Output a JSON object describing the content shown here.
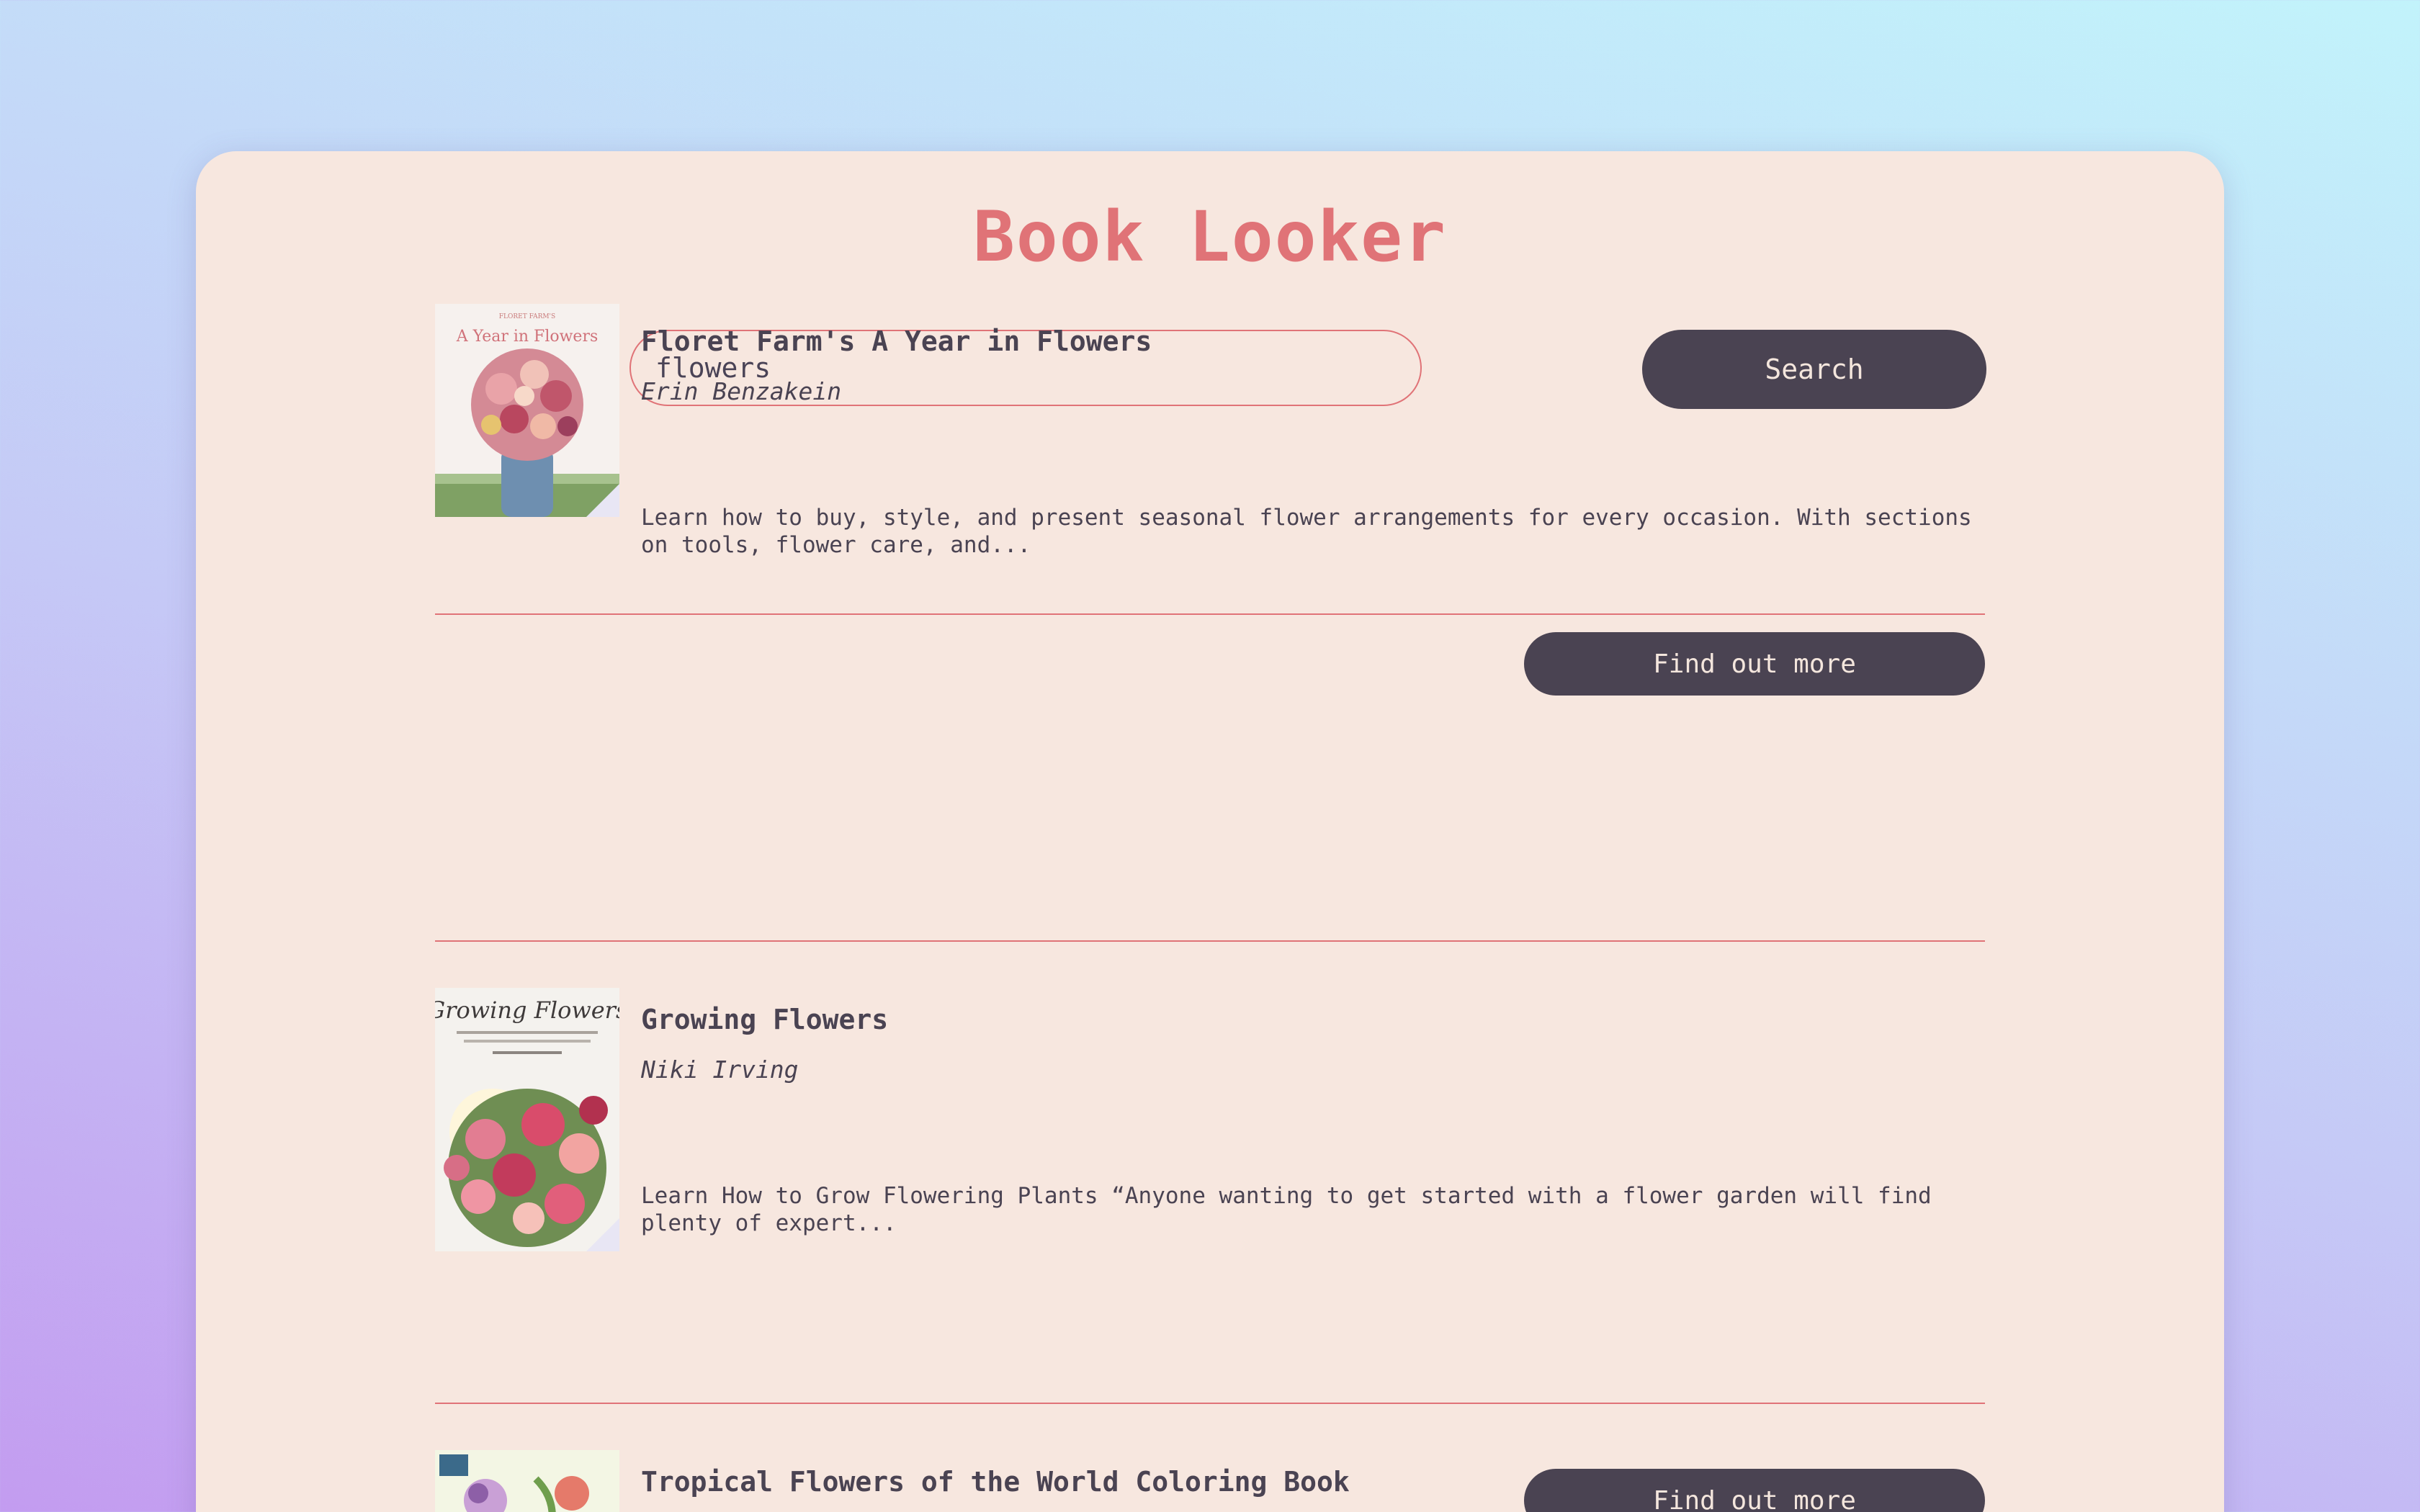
{
  "app": {
    "title": "Book Looker"
  },
  "search": {
    "value": "flowers",
    "button_label": "Search"
  },
  "results": [
    {
      "title": "Floret Farm's A Year in Flowers",
      "author": "Erin Benzakein",
      "description": "Learn how to buy, style, and present seasonal flower arrangements for every occasion. With sections on tools, flower care, and...",
      "button_label": "Find out more",
      "cover_text": "FLORET FARM'S A Year in Flowers"
    },
    {
      "title": "Growing Flowers",
      "author": "Niki Irving",
      "description": "Learn How to Grow Flowering Plants “Anyone wanting to get started with a flower garden will find plenty of expert...",
      "button_label": "Find out more",
      "cover_text": "Growing Flowers"
    },
    {
      "title": "Tropical Flowers of the World Coloring Book",
      "author": "",
      "description": "",
      "button_label": "",
      "cover_text": ""
    }
  ],
  "colors": {
    "accent": "#e07377",
    "dark": "#4a4352",
    "card": "#f7e7df"
  }
}
